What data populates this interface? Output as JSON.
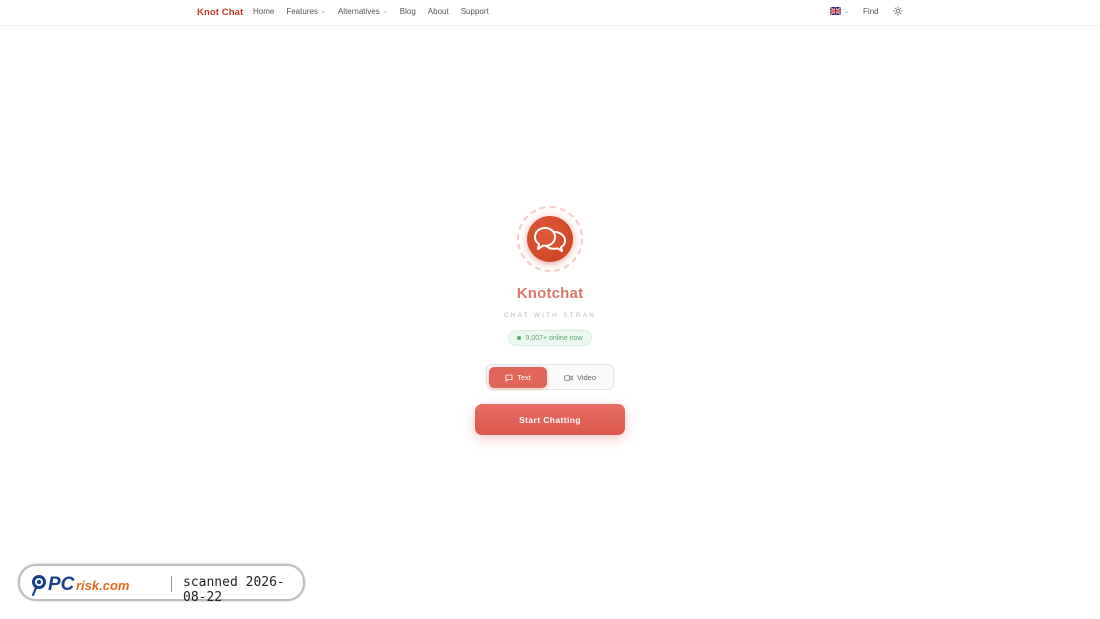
{
  "nav": {
    "brand": "Knot Chat",
    "links": [
      {
        "label": "Home",
        "dropdown": false
      },
      {
        "label": "Features",
        "dropdown": true
      },
      {
        "label": "Alternatives",
        "dropdown": true
      },
      {
        "label": "Blog",
        "dropdown": false
      },
      {
        "label": "About",
        "dropdown": false
      },
      {
        "label": "Support",
        "dropdown": false
      }
    ],
    "language_icon": "uk-flag-icon",
    "find_label": "Find",
    "theme_icon": "sun-icon"
  },
  "hero": {
    "logo_icon": "chat-bubbles-icon",
    "title": "Knotchat",
    "subtitle": "CHAT WITH STRAN",
    "online_text": "9,007+ online now",
    "modes": [
      {
        "label": "Text",
        "icon": "message-icon",
        "selected": true
      },
      {
        "label": "Video",
        "icon": "video-camera-icon",
        "selected": false
      }
    ],
    "cta_label": "Start Chatting"
  },
  "watermark": {
    "brand": "PCrisk.com",
    "scanned_text": "scanned 2026-08-22"
  },
  "colors": {
    "accent": "#e2675b",
    "brand": "#c0392b",
    "logo": "#c8401f",
    "online": "#56b26e"
  }
}
